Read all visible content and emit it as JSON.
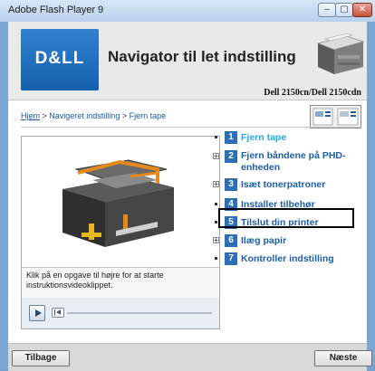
{
  "window": {
    "title": "Adobe Flash Player 9",
    "controls": {
      "minimize": "–",
      "maximize": "▢",
      "close": "✕"
    }
  },
  "header": {
    "logo": "D&LL",
    "title": "Navigator til let indstilling",
    "model": "Dell 2150cn/Dell 2150cdn"
  },
  "breadcrumb": {
    "home": "Hjem",
    "sep1": " > ",
    "section": "Navigeret indstilling",
    "sep2": " > ",
    "current": "Fjern tape"
  },
  "video": {
    "caption": "Klik på en opgave til højre for at starte instruktionsvideoklippet.",
    "progress": 0
  },
  "steps": [
    {
      "number": "1",
      "label": "Fjern tape",
      "active": true,
      "expandable": false
    },
    {
      "number": "2",
      "label": "Fjern båndene på PHD-enheden",
      "active": false,
      "expandable": true
    },
    {
      "number": "3",
      "label": "Isæt tonerpatroner",
      "active": false,
      "expandable": true
    },
    {
      "number": "4",
      "label": "Installer tilbehør",
      "active": false,
      "expandable": false
    },
    {
      "number": "5",
      "label": "Tilslut din printer",
      "active": false,
      "expandable": false
    },
    {
      "number": "6",
      "label": "Ilæg papir",
      "active": false,
      "expandable": true
    },
    {
      "number": "7",
      "label": "Kontroller indstilling",
      "active": false,
      "expandable": false
    }
  ],
  "footer": {
    "back": "Tilbage",
    "next": "Næste"
  },
  "colors": {
    "dell_blue": "#1f6fbf",
    "step_blue": "#1d5fa6",
    "active_cyan": "#20a8df"
  }
}
